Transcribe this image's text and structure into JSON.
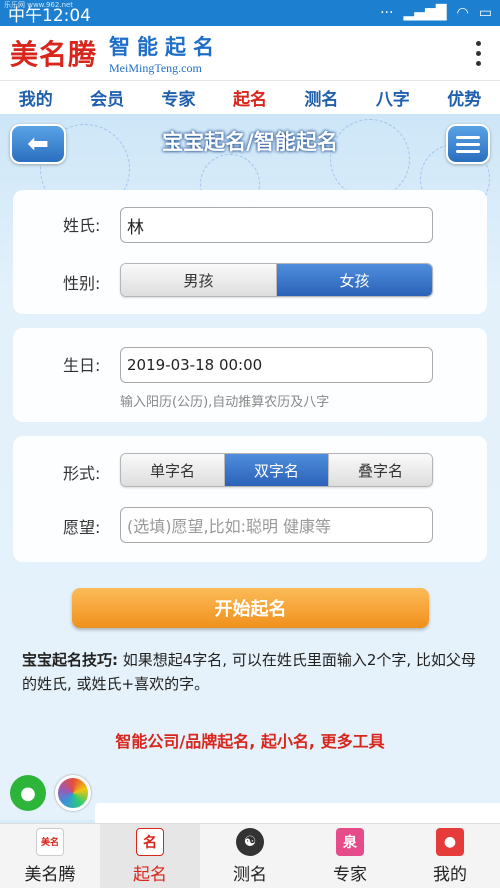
{
  "status": {
    "time": "中午12:04",
    "tiny": "乐乐网 www.962.net"
  },
  "header": {
    "logo": "美名腾",
    "brand_title": "智能起名",
    "brand_url": "MeiMingTeng.com"
  },
  "nav": [
    "我的",
    "会员",
    "专家",
    "起名",
    "测名",
    "八字",
    "优势"
  ],
  "nav_active": "起名",
  "page": {
    "title": "宝宝起名/智能起名",
    "back_icon": "back-arrow-icon",
    "menu_icon": "hamburger-icon"
  },
  "form": {
    "surname_label": "姓氏:",
    "surname_value": "林",
    "gender_label": "性别:",
    "gender_options": [
      "男孩",
      "女孩"
    ],
    "gender_selected": "女孩",
    "birthday_label": "生日:",
    "birthday_value": "2019-03-18 00:00",
    "birthday_hint": "输入阳历(公历),自动推算农历及八字",
    "form_label": "形式:",
    "form_options": [
      "单字名",
      "双字名",
      "叠字名"
    ],
    "form_selected": "双字名",
    "wish_label": "愿望:",
    "wish_placeholder": "(选填)愿望,比如:聪明 健康等"
  },
  "start_button": "开始起名",
  "tip": {
    "title": "宝宝起名技巧:",
    "body": " 如果想起4字名, 可以在姓氏里面输入2个字, 比如父母的姓氏, 或姓氏+喜欢的字。"
  },
  "links": {
    "a": "智能公司/品牌起名",
    "sep1": ",",
    "b": "起小名",
    "sep2": ",",
    "c": "更多工具"
  },
  "tabbar": [
    {
      "label": "美名腾",
      "icon": "logo-icon"
    },
    {
      "label": "起名",
      "icon": "naming-icon"
    },
    {
      "label": "测名",
      "icon": "yinyang-icon"
    },
    {
      "label": "专家",
      "icon": "expert-icon"
    },
    {
      "label": "我的",
      "icon": "user-icon"
    }
  ],
  "colors": {
    "brand_blue": "#1f6fc8",
    "accent_red": "#d9261c",
    "orange": "#f0901b",
    "status_blue": "#1c7fd0"
  }
}
